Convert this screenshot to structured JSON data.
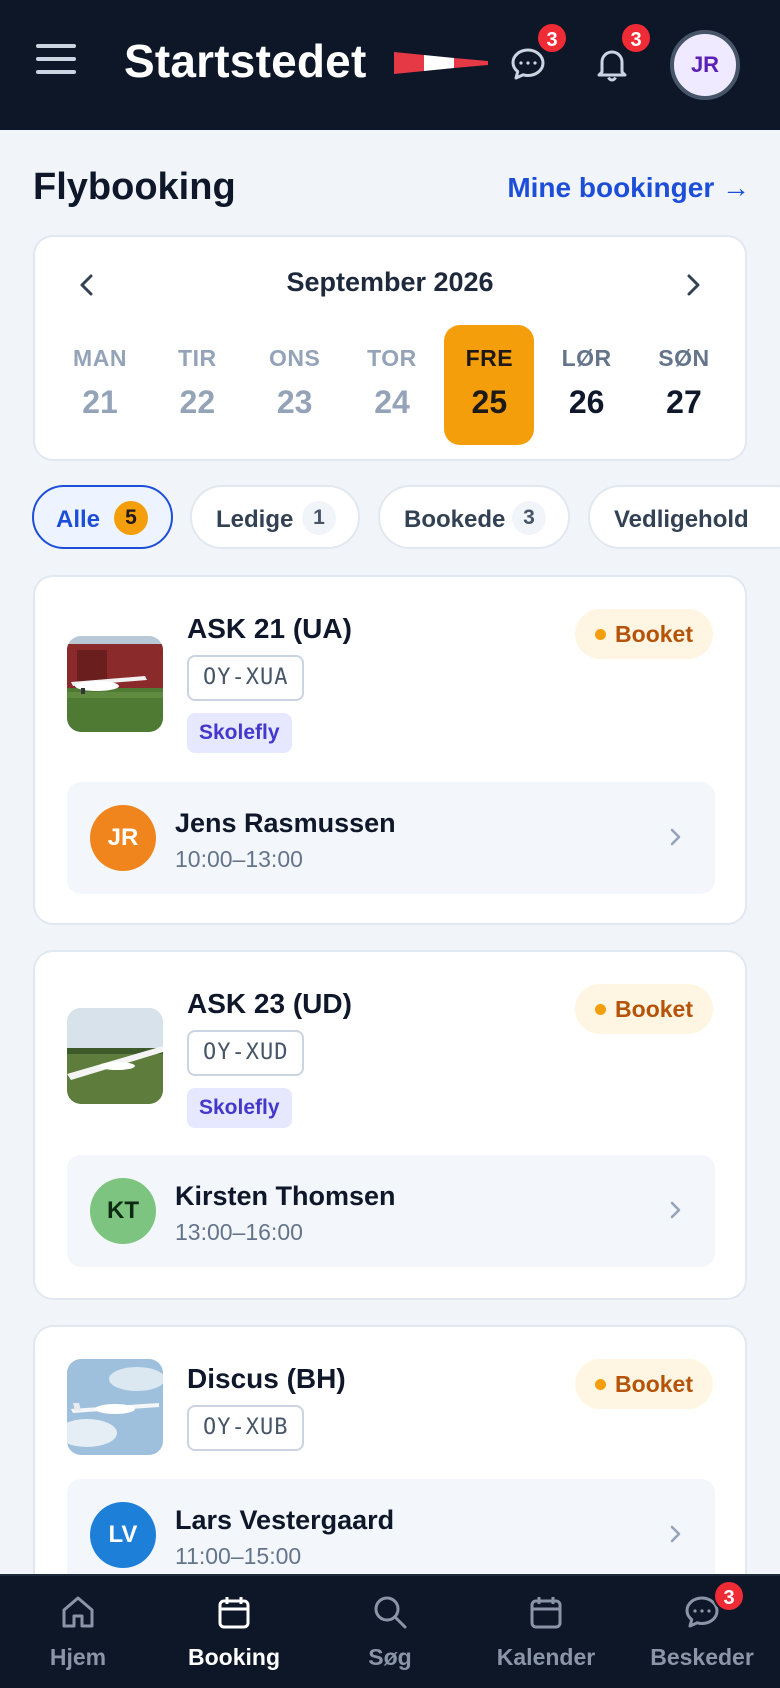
{
  "header": {
    "brand": "Startstedet",
    "messages_badge": "3",
    "notifications_badge": "3",
    "avatar_initials": "JR",
    "flag_colors": [
      "#e63946",
      "#ffffff"
    ]
  },
  "page": {
    "title": "Flybooking",
    "my_bookings_link": "Mine bookinger →"
  },
  "calendar": {
    "month": "September 2026",
    "days": [
      {
        "name": "MAN",
        "num": "21"
      },
      {
        "name": "TIR",
        "num": "22"
      },
      {
        "name": "ONS",
        "num": "23"
      },
      {
        "name": "TOR",
        "num": "24"
      },
      {
        "name": "FRE",
        "num": "25"
      },
      {
        "name": "LØR",
        "num": "26"
      },
      {
        "name": "SØN",
        "num": "27"
      }
    ],
    "selected_index": 4
  },
  "filters": [
    {
      "label": "Alle",
      "count": "5"
    },
    {
      "label": "Ledige",
      "count": "1"
    },
    {
      "label": "Bookede",
      "count": "3"
    },
    {
      "label": "Vedligehold",
      "count": ""
    }
  ],
  "aircraft": [
    {
      "name": "ASK 21 (UA)",
      "registration": "OY-XUA",
      "tag": "Skolefly",
      "status": "Booket",
      "booking": {
        "initials": "JR",
        "person": "Jens Rasmussen",
        "time": "10:00–13:00",
        "avatar_color": "#f0851d"
      }
    },
    {
      "name": "ASK 23 (UD)",
      "registration": "OY-XUD",
      "tag": "Skolefly",
      "status": "Booket",
      "booking": {
        "initials": "KT",
        "person": "Kirsten Thomsen",
        "time": "13:00–16:00",
        "avatar_color": "#7cc47f"
      }
    },
    {
      "name": "Discus (BH)",
      "registration": "OY-XUB",
      "tag": "",
      "status": "Booket",
      "booking": {
        "initials": "LV",
        "person": "Lars Vestergaard",
        "time": "11:00–15:00",
        "avatar_color": "#1e7fd8"
      }
    }
  ],
  "bottom_nav": {
    "items": [
      {
        "label": "Hjem",
        "icon": "home-icon"
      },
      {
        "label": "Booking",
        "icon": "calendar-icon"
      },
      {
        "label": "Søg",
        "icon": "search-icon"
      },
      {
        "label": "Kalender",
        "icon": "calendar-icon"
      },
      {
        "label": "Beskeder",
        "icon": "chat-icon"
      }
    ],
    "active": "Booking",
    "messages_badge": "3"
  },
  "colors": {
    "header_bg": "#0e1728",
    "accent_blue": "#1d4ed8",
    "selected_day": "#f59e0b",
    "status_booked": "#b45309",
    "badge_red": "#ef2b36"
  }
}
